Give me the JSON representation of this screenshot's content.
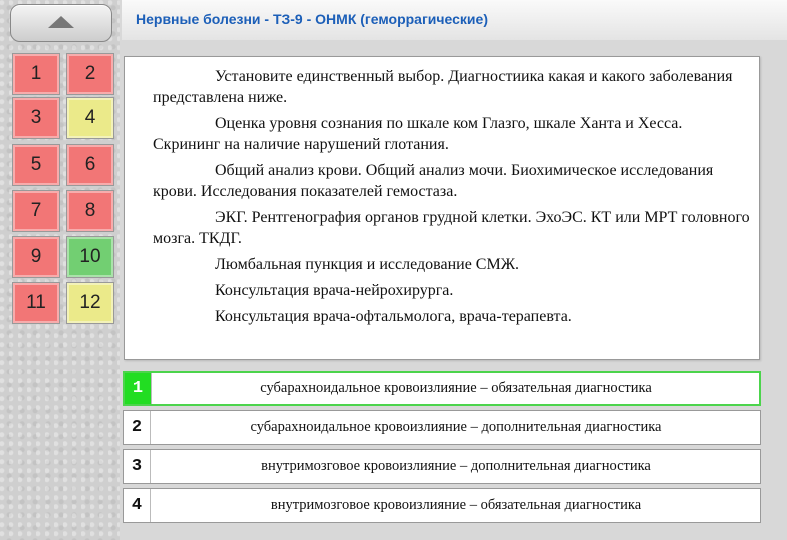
{
  "header": {
    "title": "Нервные болезни - ТЗ-9 - ОНМК (геморрагические)"
  },
  "sidebar": {
    "question_buttons": [
      {
        "label": "1",
        "status": "red"
      },
      {
        "label": "2",
        "status": "red"
      },
      {
        "label": "3",
        "status": "red"
      },
      {
        "label": "4",
        "status": "yellow"
      },
      {
        "label": "5",
        "status": "red"
      },
      {
        "label": "6",
        "status": "red"
      },
      {
        "label": "7",
        "status": "red"
      },
      {
        "label": "8",
        "status": "red"
      },
      {
        "label": "9",
        "status": "red"
      },
      {
        "label": "10",
        "status": "green"
      },
      {
        "label": "11",
        "status": "red"
      },
      {
        "label": "12",
        "status": "yellow"
      }
    ]
  },
  "question": {
    "paragraphs": [
      "Установите единственный выбор. Диагностиика какая и какого заболевания представлена ниже.",
      "Оценка уровня сознания по шкале ком Глазго, шкале Ханта и Хесса. Скрининг на наличие нарушений глотания.",
      "Общий анализ крови. Общий анализ мочи. Биохимическое исследования крови. Исследования показателей гемостаза.",
      "ЭКГ. Рентгенография органов грудной клетки. ЭхоЭС. КТ или МРТ головного мозга. ТКДГ.",
      "Люмбальная пункция и исследование СМЖ.",
      "Консультация врача-нейрохирурга.",
      "Консультация врача-офтальмолога, врача-терапевта."
    ]
  },
  "answers": [
    {
      "number": "1",
      "label": "субарахноидальное кровоизлияние – обязательная диагностика",
      "selected": true
    },
    {
      "number": "2",
      "label": "субарахноидальное кровоизлияние – дополнительная диагностика",
      "selected": false
    },
    {
      "number": "3",
      "label": "внутримозговое кровоизлияние – дополнительная диагностика",
      "selected": false
    },
    {
      "number": "4",
      "label": "внутримозговое кровоизлияние – обязательная диагностика",
      "selected": false
    }
  ],
  "colors": {
    "red": "#f27676",
    "yellow": "#ebea8a",
    "green": "#72cf72",
    "title": "#1c5fb8",
    "selected_answer": "#22dd22"
  },
  "icons": {
    "scroll_up": "triangle-up-icon"
  }
}
